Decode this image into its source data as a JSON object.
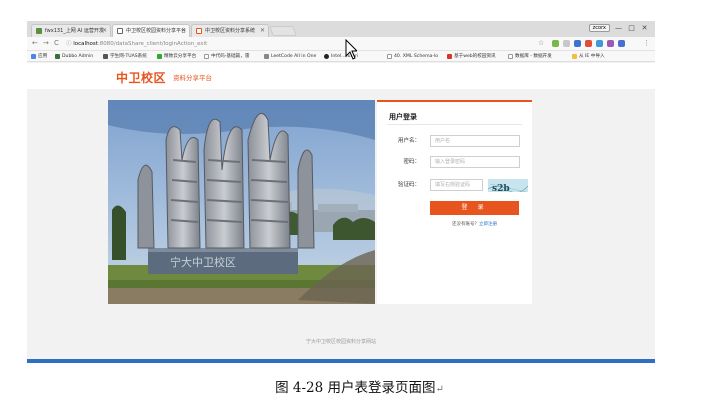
{
  "browser": {
    "tabs": [
      {
        "label": "fwx131_上网 AI 运营开发",
        "active": false,
        "fav_color": "#5a8f3c"
      },
      {
        "label": "中卫校区校园资料分享平台",
        "active": true,
        "fav_color": "#666666"
      },
      {
        "label": "中卫校区资料分享系统",
        "active": false,
        "fav_color": "#e8541e"
      }
    ],
    "user_badge": "zcorx",
    "window_controls": [
      "—",
      "□",
      "✕"
    ],
    "nav": {
      "back": "←",
      "forward": "→",
      "reload": "C"
    },
    "url_host": "localhost",
    "url_rest": ":8080/dataShare_client/loginAction_exit",
    "bookmarks": [
      {
        "label": "应用",
        "color": "#4a86e8"
      },
      {
        "label": "Dubbo Admin",
        "color": "#3c6e3c"
      },
      {
        "label": "学生网-TUAS系统",
        "color": "#555555"
      },
      {
        "label": "精致云分享平台",
        "color": "#2eaa2e"
      },
      {
        "label": "中代码-基础篇，雷",
        "color": "#ffffff"
      },
      {
        "label": "LeetCode All in One",
        "color": "#888888"
      },
      {
        "label": "Intel...Tutori",
        "color": "#222222"
      },
      {
        "label": "40. XML Schema-lo",
        "color": "#ffffff"
      },
      {
        "label": "基于web的校园资讯",
        "color": "#d9342b"
      },
      {
        "label": "数据库 - 数据开发",
        "color": "#ffffff"
      },
      {
        "label": "从 IE 中导入",
        "color": "#f0c040"
      }
    ]
  },
  "page": {
    "brand": "中卫校区",
    "brand_sub": "资料分享平台",
    "login": {
      "title": "用户登录",
      "username_label": "用户名：",
      "username_placeholder": "用户名",
      "password_label": "密码：",
      "password_placeholder": "输入登录密码",
      "captcha_label": "验证码：",
      "captcha_placeholder": "填写右侧验证码",
      "captcha_text": "s2b",
      "submit_label": "登 录",
      "register_text": "还没有账号？",
      "register_link": "立即注册"
    },
    "footer": "宁大中卫校区校园资料分享网站"
  },
  "caption": {
    "text": "图 4-28  用户表登录页面图",
    "para_mark": "↵"
  },
  "colors": {
    "accent": "#e8541e",
    "link": "#2a73c9",
    "taskbar": "#2e6fbf"
  }
}
